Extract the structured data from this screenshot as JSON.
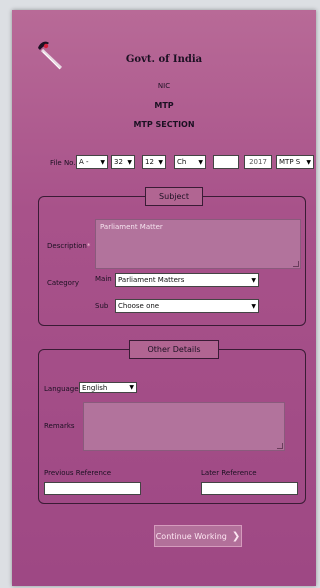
{
  "header": {
    "org": "Govt. of India",
    "nic": "NIC",
    "app": "MTP",
    "section": "MTP SECTION"
  },
  "file_no": {
    "label": "File No.",
    "required_mark": "*",
    "parts": [
      "A -",
      "32",
      "12",
      "Ch",
      "",
      "2017",
      "MTP S"
    ]
  },
  "subject": {
    "legend": "Subject",
    "description_label": "Description",
    "required_mark": "*",
    "description_value": "Parliament Matter",
    "category_label": "Category",
    "main_label": "Main",
    "main_value": "Parliament Matters",
    "sub_label": "Sub",
    "sub_value": "Choose one"
  },
  "other": {
    "legend": "Other Details",
    "language_label": "Language",
    "language_value": "English",
    "remarks_label": "Remarks",
    "prev_ref_label": "Previous Reference",
    "later_ref_label": "Later Reference"
  },
  "actions": {
    "continue_label": "Continue Working",
    "continue_icon": "chevron-right-icon"
  },
  "colors": {
    "panel": "#a8528a",
    "page_bg": "#dcdfe3"
  }
}
